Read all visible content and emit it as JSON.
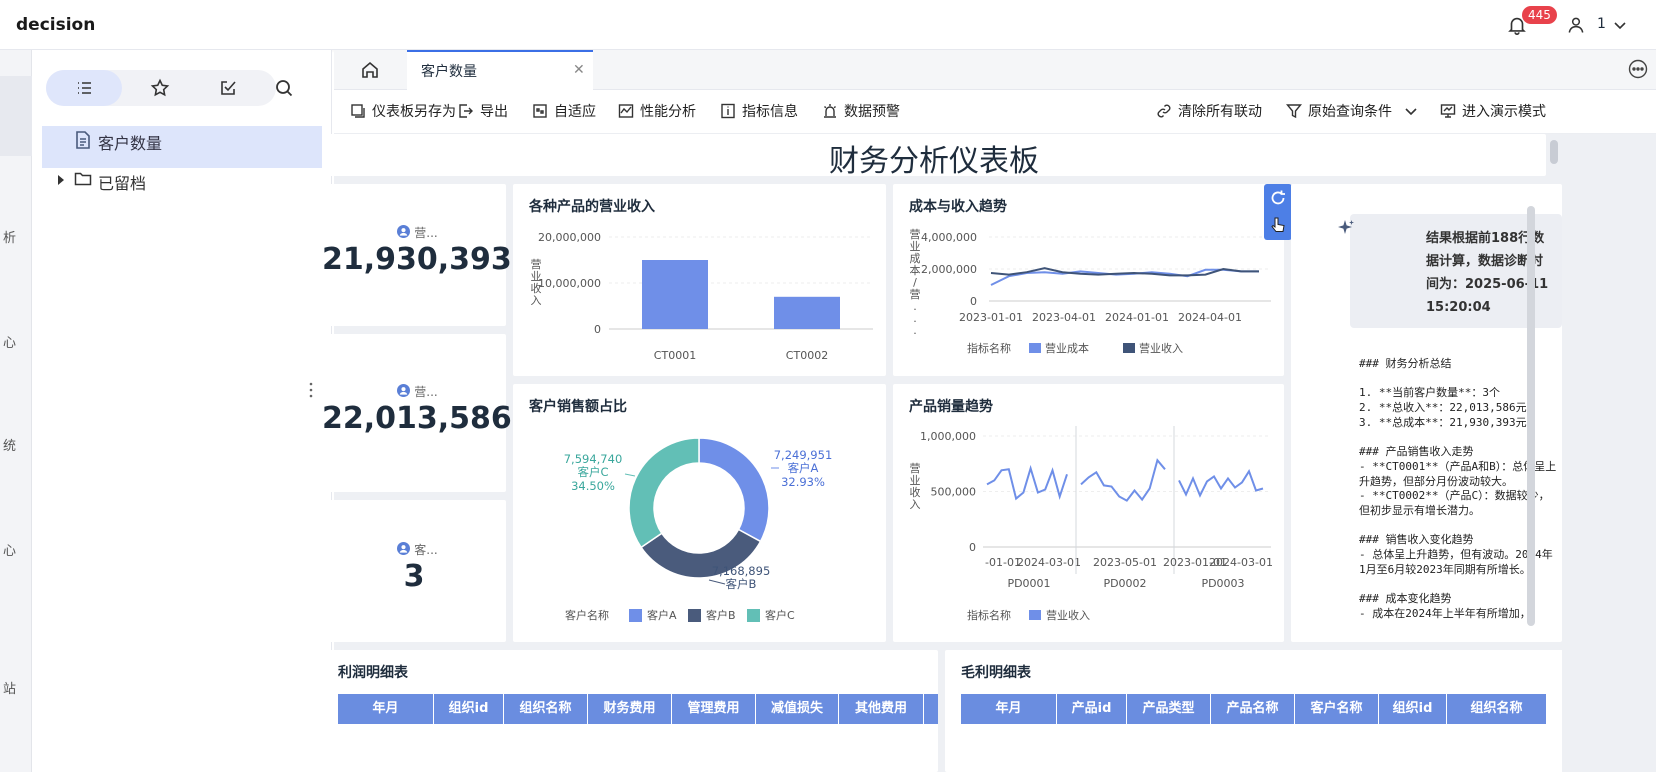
{
  "app": {
    "brand": "decision",
    "notification_count": "445",
    "user": "1"
  },
  "rail": {
    "items": [
      "析",
      "心",
      "统",
      "心",
      "站"
    ]
  },
  "sidebar": {
    "items": [
      {
        "label": "客户数量",
        "selected": true
      },
      {
        "label": "已留档",
        "selected": false
      }
    ]
  },
  "tabs": {
    "active": "客户数量"
  },
  "toolbar": {
    "save_as": "仪表板另存为",
    "export": "导出",
    "adaptive": "自适应",
    "perf": "性能分析",
    "metric_info": "指标信息",
    "alert": "数据预警",
    "clear_links": "清除所有联动",
    "orig_query": "原始查询条件",
    "present": "进入演示模式"
  },
  "dashboard": {
    "title": "财务分析仪表板"
  },
  "kpis": [
    {
      "label": "营...",
      "value": "21,930,393"
    },
    {
      "label": "营...",
      "value": "22,013,586"
    },
    {
      "label": "客...",
      "value": "3"
    }
  ],
  "chart_data": [
    {
      "type": "bar",
      "title": "各种产品的营业收入",
      "ylabel": "营业收入",
      "categories": [
        "CT0001",
        "CT0002"
      ],
      "values": [
        15000000,
        7000000
      ],
      "ylim": [
        0,
        20000000
      ],
      "yticks": [
        "20,000,000",
        "10,000,000",
        "0"
      ],
      "color": "#6f8fe8"
    },
    {
      "type": "line",
      "title": "成本与收入趋势",
      "ylabel": "营业成本/营...",
      "x_ticks": [
        "2023-01-01",
        "2023-04-01",
        "2024-01-01",
        "2024-04-01"
      ],
      "yticks": [
        "4,000,000",
        "2,000,000",
        "0"
      ],
      "ylim": [
        0,
        4000000
      ],
      "legend_title": "指标名称",
      "series": [
        {
          "name": "营业成本",
          "color": "#6f8fe8",
          "values": [
            1000000,
            1550000,
            1750000,
            1800000,
            1700000,
            1850000,
            1750000,
            1650000,
            1700000,
            1800000,
            1700000,
            1550000,
            1950000,
            1950000,
            1850000,
            1850000
          ]
        },
        {
          "name": "营业收入",
          "color": "#3f5478",
          "values": [
            1750000,
            1650000,
            1800000,
            2050000,
            1800000,
            1700000,
            1650000,
            1700000,
            1750000,
            1700000,
            1600000,
            1600000,
            1650000,
            2000000,
            1850000,
            1850000
          ]
        }
      ]
    },
    {
      "type": "pie",
      "title": "客户销售额占比",
      "legend_title": "客户名称",
      "slices": [
        {
          "name": "客户A",
          "value": 7249951,
          "label": "7,249,951",
          "pct": "32.93%",
          "color": "#6f8fe8"
        },
        {
          "name": "客户B",
          "value": 7168895,
          "label": "7,168,895",
          "pct": "",
          "color": "#4a5b7c"
        },
        {
          "name": "客户C",
          "value": 7594740,
          "label": "7,594,740",
          "pct": "34.50%",
          "color": "#62bfb6"
        }
      ]
    },
    {
      "type": "line",
      "title": "产品销量趋势",
      "ylabel": "营业收入",
      "yticks": [
        "1,000,000",
        "500,000",
        "0"
      ],
      "ylim": [
        0,
        1100000
      ],
      "legend_title": "指标名称",
      "series_name": "营业收入",
      "color": "#6f8fe8",
      "groups": [
        {
          "name": "PD0001",
          "x_ticks": [
            "-01-01",
            "2024-03-01"
          ],
          "values": [
            620000,
            660000,
            760000,
            770000,
            480000,
            540000,
            780000,
            540000,
            570000,
            760000,
            500000,
            720000
          ]
        },
        {
          "name": "PD0002",
          "x_ticks": [
            "2023-05-01"
          ],
          "values": [
            620000,
            690000,
            740000,
            610000,
            600000,
            500000,
            460000,
            560000,
            470000,
            580000,
            860000,
            770000
          ]
        },
        {
          "name": "PD0003",
          "x_ticks": [
            "2023-01-01",
            "2024-03-01"
          ],
          "values": [
            660000,
            520000,
            680000,
            510000,
            650000,
            700000,
            580000,
            680000,
            590000,
            640000,
            750000,
            560000,
            580000
          ]
        }
      ]
    }
  ],
  "diagnosis": {
    "note": "结果根据前188行数据计算，数据诊断时间为：2025-06-11 15:20:04",
    "summary": "### 财务分析总结\n\n1. **当前客户数量**：3个\n2. **总收入**：22,013,586元\n3. **总成本**：21,930,393元\n\n### 产品销售收入走势\n- **CT0001**（产品A和B）：总体呈上升趋势，但部分月份波动较大。\n- **CT0002**（产品C）：数据较少，但初步显示有增长潜力。\n\n### 销售收入变化趋势\n- 总体呈上升趋势，但有波动。2024年1月至6月较2023年同期有所增长。\n\n### 成本变化趋势\n- 成本在2024年上半年有所增加，"
  },
  "tables": [
    {
      "title": "利润明细表",
      "columns": [
        "年月",
        "组织id",
        "组织名称",
        "财务费用",
        "管理费用",
        "减值损失",
        "其他费用"
      ]
    },
    {
      "title": "毛利明细表",
      "columns": [
        "年月",
        "产品id",
        "产品类型",
        "产品名称",
        "客户名称",
        "组织id",
        "组织名称"
      ]
    }
  ]
}
